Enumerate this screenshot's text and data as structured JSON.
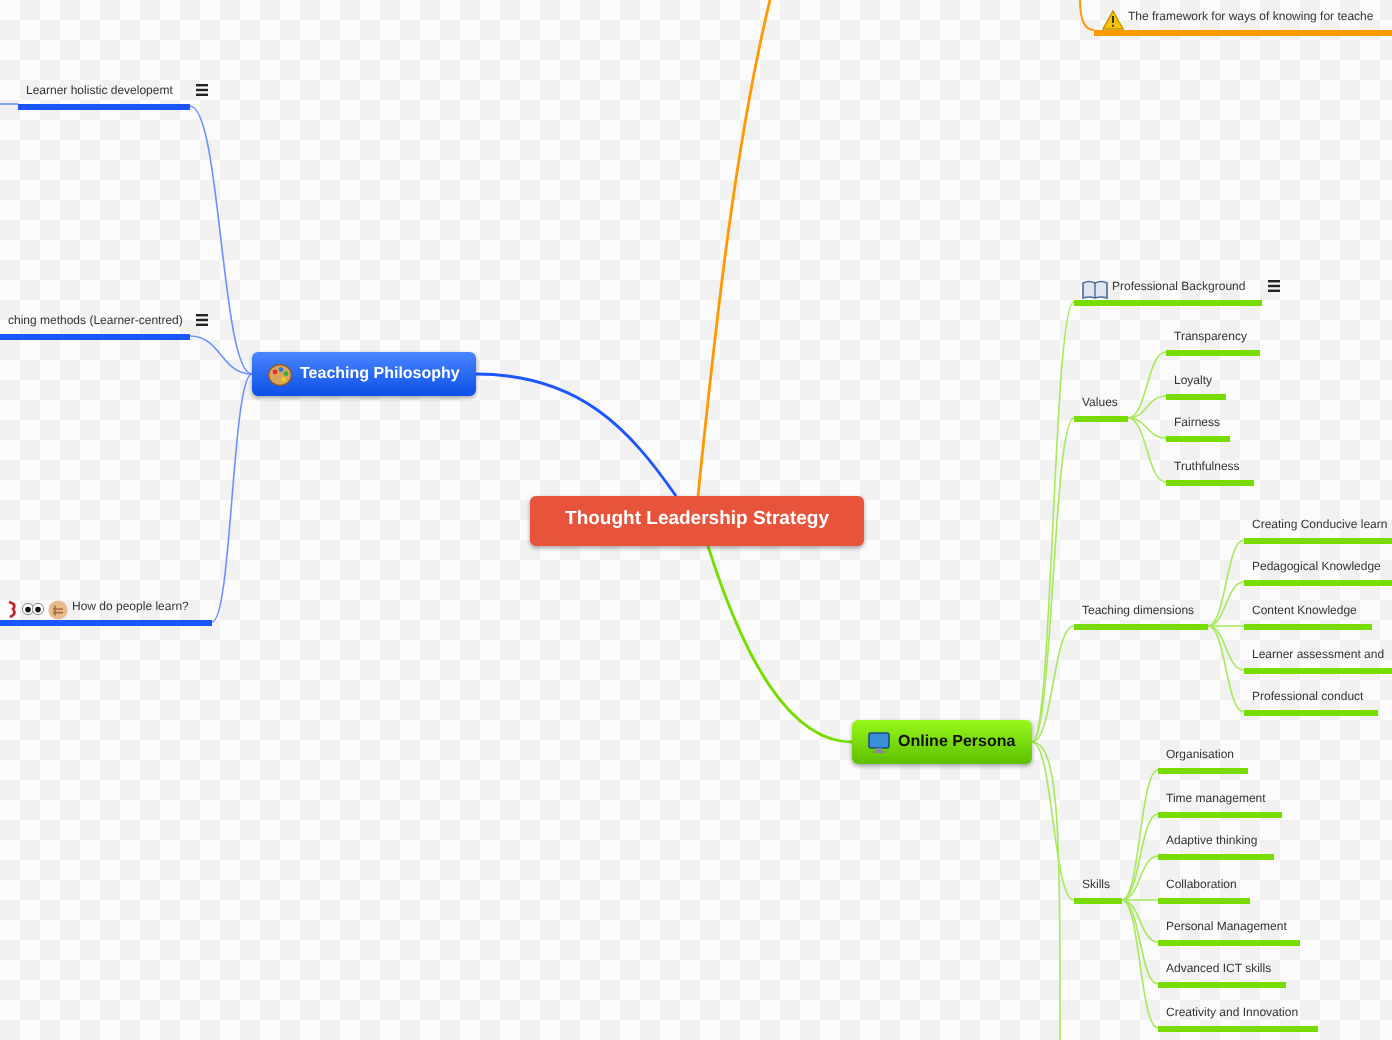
{
  "central_topic": {
    "title": "Thought Leadership Strategy"
  },
  "branches": [
    {
      "color": "#ff9900",
      "topics": [
        {
          "text": "The framework for ways of knowing for teache",
          "notes": false
        }
      ]
    },
    {
      "title": "Teaching Philosophy",
      "color": "#1a55ff",
      "topics": [
        {
          "text": "Learner holistic developemt",
          "notes": true
        },
        {
          "text": "ching methods (Learner-centred)",
          "notes": true
        },
        {
          "text": "How do people learn?",
          "notes": false
        }
      ]
    },
    {
      "title": "Online Persona",
      "color": "#77dd00",
      "topics": [
        {
          "text": "Professional Background",
          "notes": true
        },
        {
          "text": "Values",
          "notes": false,
          "children": [
            {
              "text": "Transparency",
              "notes": false
            },
            {
              "text": "Loyalty",
              "notes": false
            },
            {
              "text": "Fairness",
              "notes": false
            },
            {
              "text": "Truthfulness",
              "notes": false
            }
          ]
        },
        {
          "text": "Teaching dimensions",
          "notes": false,
          "children": [
            {
              "text": "Creating Conducive learn",
              "notes": false
            },
            {
              "text": "Pedagogical Knowledge",
              "notes": false
            },
            {
              "text": "Content Knowledge",
              "notes": false
            },
            {
              "text": "Learner assessment and",
              "notes": false
            },
            {
              "text": "Professional conduct",
              "notes": false
            }
          ]
        },
        {
          "text": "Skills",
          "notes": false,
          "children": [
            {
              "text": "Organisation",
              "notes": false
            },
            {
              "text": "Time management",
              "notes": false
            },
            {
              "text": "Adaptive thinking",
              "notes": false
            },
            {
              "text": "Collaboration",
              "notes": false
            },
            {
              "text": "Personal Management",
              "notes": false
            },
            {
              "text": "Advanced ICT skills",
              "notes": false
            },
            {
              "text": "Creativity and Innovation",
              "notes": false
            }
          ]
        }
      ]
    }
  ]
}
